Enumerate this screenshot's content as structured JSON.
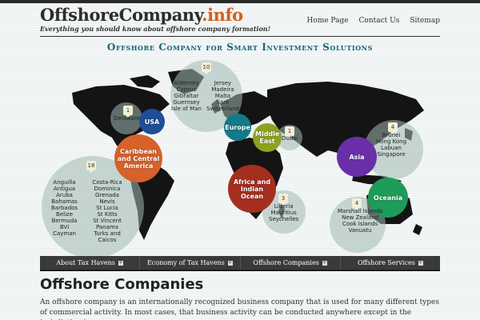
{
  "site": {
    "logo_main": "OffshoreCompany",
    "logo_tld": ".info",
    "tagline": "Everything you should know about offshore company formation!"
  },
  "nav": [
    {
      "label": "Home Page"
    },
    {
      "label": "Contact Us"
    },
    {
      "label": "Sitemap"
    }
  ],
  "banner": "Offshore Company for Smart Investment Solutions",
  "map": {
    "groups": [
      {
        "count": "10",
        "items": [
          "Alderney",
          "Cyprus",
          "Gibraltar",
          "Guernsey",
          "Isle of Man"
        ],
        "items2": [
          "Jersey",
          "Madeira",
          "Malta",
          "Sark",
          "Switzerland"
        ]
      },
      {
        "count": "1",
        "items": [
          "Delaware"
        ]
      },
      {
        "count": "18",
        "items": [
          "Anguilla",
          "Antigua",
          "Aruba",
          "Bahamas",
          "Barbados",
          "Belize",
          "Bermuda",
          "BVI",
          "Cayman"
        ],
        "items2": [
          "Costa-Rica",
          "Dominica",
          "Grenada",
          "Nevis",
          "St Lucia",
          "St Kitts",
          "St Vincent",
          "Panama",
          "Turks and Caicos"
        ]
      },
      {
        "count": "1",
        "items": [
          "Dubai"
        ]
      },
      {
        "count": "3",
        "items": [
          "Liberia",
          "Mauritius",
          "Seychelles"
        ]
      },
      {
        "count": "4",
        "items": [
          "Brunei",
          "Hong Kong",
          "Labuan",
          "Singapore"
        ]
      },
      {
        "count": "4",
        "items": [
          "Marshall Islands",
          "New Zealand",
          "Cook Islands",
          "Vanuatu"
        ]
      }
    ],
    "regions": [
      "USA",
      "Caribbean and Central America",
      "Europe",
      "Middle East",
      "Africa and Indian Ocean",
      "Asia",
      "Oceania"
    ],
    "colors": {
      "usa": "#1e4f96",
      "caribbean": "#d6622a",
      "europe": "#147a87",
      "middle_east": "#8ea222",
      "africa": "#a52f1f",
      "asia": "#6a2fa8",
      "oceania": "#1e9b59"
    }
  },
  "menu": [
    {
      "label": "About Tax Havens"
    },
    {
      "label": "Economy of Tax Havens"
    },
    {
      "label": "Offshore Companies"
    },
    {
      "label": "Offshore Services"
    }
  ],
  "article": {
    "title": "Offshore Companies",
    "text": "An offshore company is an internationally recognized business company that is used for many different types of commercial activity. In most cases, that business activity can be conducted anywhere except in the jurisdiction in"
  }
}
